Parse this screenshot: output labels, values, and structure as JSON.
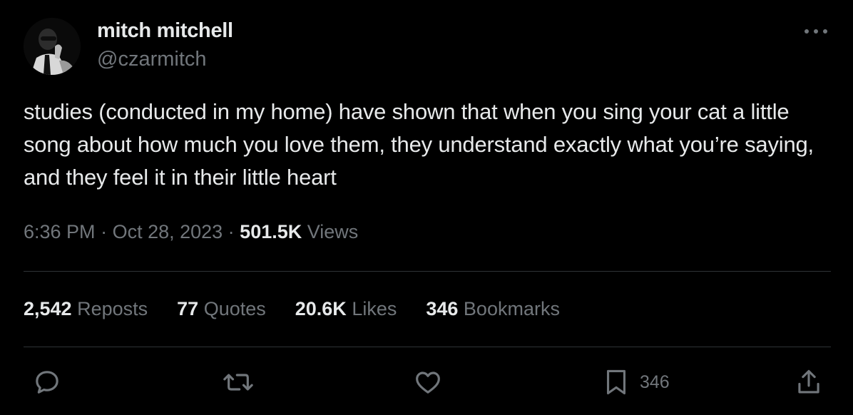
{
  "author": {
    "display_name": "mitch mitchell",
    "handle": "@czarmitch",
    "avatar_icon": "profile-photo"
  },
  "tweet": {
    "text": "studies (conducted in my home) have shown that when you sing your cat a little song about how much you love them, they understand exactly what you’re saying, and they feel it in their little heart",
    "time": "6:36 PM",
    "sep1": " · ",
    "date": "Oct 28, 2023",
    "sep2": " · ",
    "views_count": "501.5K",
    "views_label": " Views"
  },
  "stats": {
    "reposts": {
      "count": "2,542",
      "label": " Reposts"
    },
    "quotes": {
      "count": "77",
      "label": " Quotes"
    },
    "likes": {
      "count": "20.6K",
      "label": " Likes"
    },
    "bookmarks": {
      "count": "346",
      "label": " Bookmarks"
    }
  },
  "actions": {
    "reply_icon": "speech-bubble",
    "repost_icon": "repost-arrows",
    "like_icon": "heart",
    "bookmark_icon": "bookmark",
    "bookmark_count": "346",
    "share_icon": "share-upload"
  },
  "colors": {
    "background": "#000000",
    "primary_text": "#e7e9ea",
    "secondary_text": "#71767b",
    "divider": "#2f3336"
  }
}
